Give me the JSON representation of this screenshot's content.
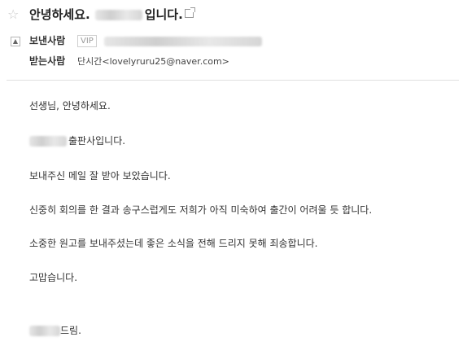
{
  "header": {
    "star_icon": "star-outline-icon",
    "subject_prefix": "안녕하세요.",
    "subject_suffix": "입니다.",
    "popout_icon": "open-new-window-icon"
  },
  "sender": {
    "toggle_symbol": "▲",
    "label": "보낸사람",
    "badge": "VIP"
  },
  "recipient": {
    "label": "받는사람",
    "value": "단시간<lovelyruru25@naver.com>"
  },
  "body": {
    "greeting": "선생님, 안녕하세요.",
    "publisher_suffix": "출판사입니다.",
    "p1": "보내주신 메일 잘 받아 보았습니다.",
    "p2": "신중히 회의를 한 결과 송구스럽게도 저희가 아직 미숙하여 출간이 어려울 듯 합니다.",
    "p3": "소중한 원고를 보내주셨는데 좋은 소식을 전해 드리지 못해 죄송합니다.",
    "p4": "고맙습니다.",
    "signoff_suffix": " 드림."
  }
}
